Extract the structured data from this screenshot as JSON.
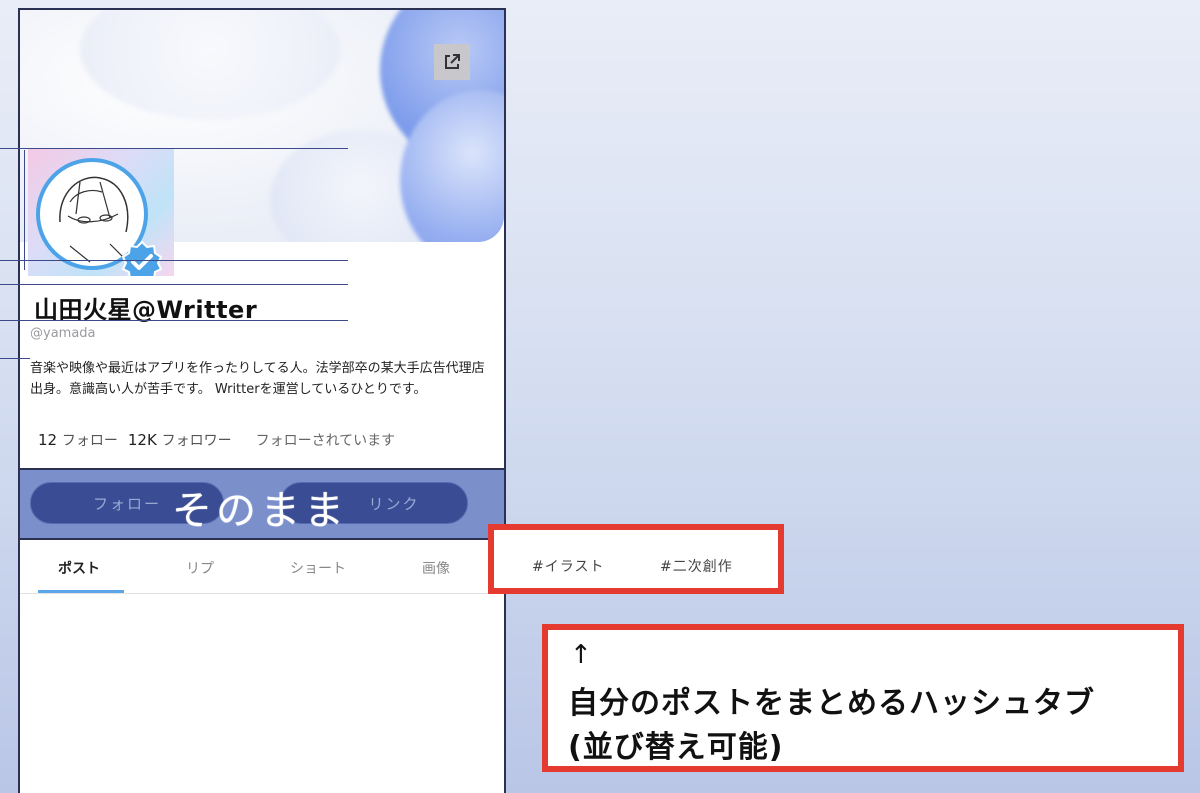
{
  "profile": {
    "name": "山田火星@Writter",
    "handle": "@yamada",
    "bio": "音楽や映像や最近はアプリを作ったりしてる人。法学部卒の某大手広告代理店出身。意識高い人が苦手です。 Writterを運営しているひとりです。",
    "following_count": "12",
    "following_label": "フォロー",
    "followers_count": "12K",
    "followers_label": "フォロワー",
    "follows_you": "フォローされています"
  },
  "actions": {
    "follow_label": "フォロー",
    "link_label": "リンク",
    "overlay_text": "そのまま"
  },
  "tabs": [
    {
      "label": "ポスト",
      "active": true
    },
    {
      "label": "リプ",
      "active": false
    },
    {
      "label": "ショート",
      "active": false
    },
    {
      "label": "画像",
      "active": false
    }
  ],
  "hashtags": [
    "#イラスト",
    "#二次創作"
  ],
  "note": {
    "arrow": "↑",
    "line1": "自分のポストをまとめるハッシュタブ",
    "line2": "(並び替え可能)"
  },
  "colors": {
    "accent_blue": "#5aa6e8",
    "highlight_red": "#e43a2f",
    "band_blue": "#7b8fcb",
    "frame_navy": "#2a3152"
  },
  "icons": {
    "external_link": "external-link-icon",
    "verified": "verified-badge-icon"
  }
}
